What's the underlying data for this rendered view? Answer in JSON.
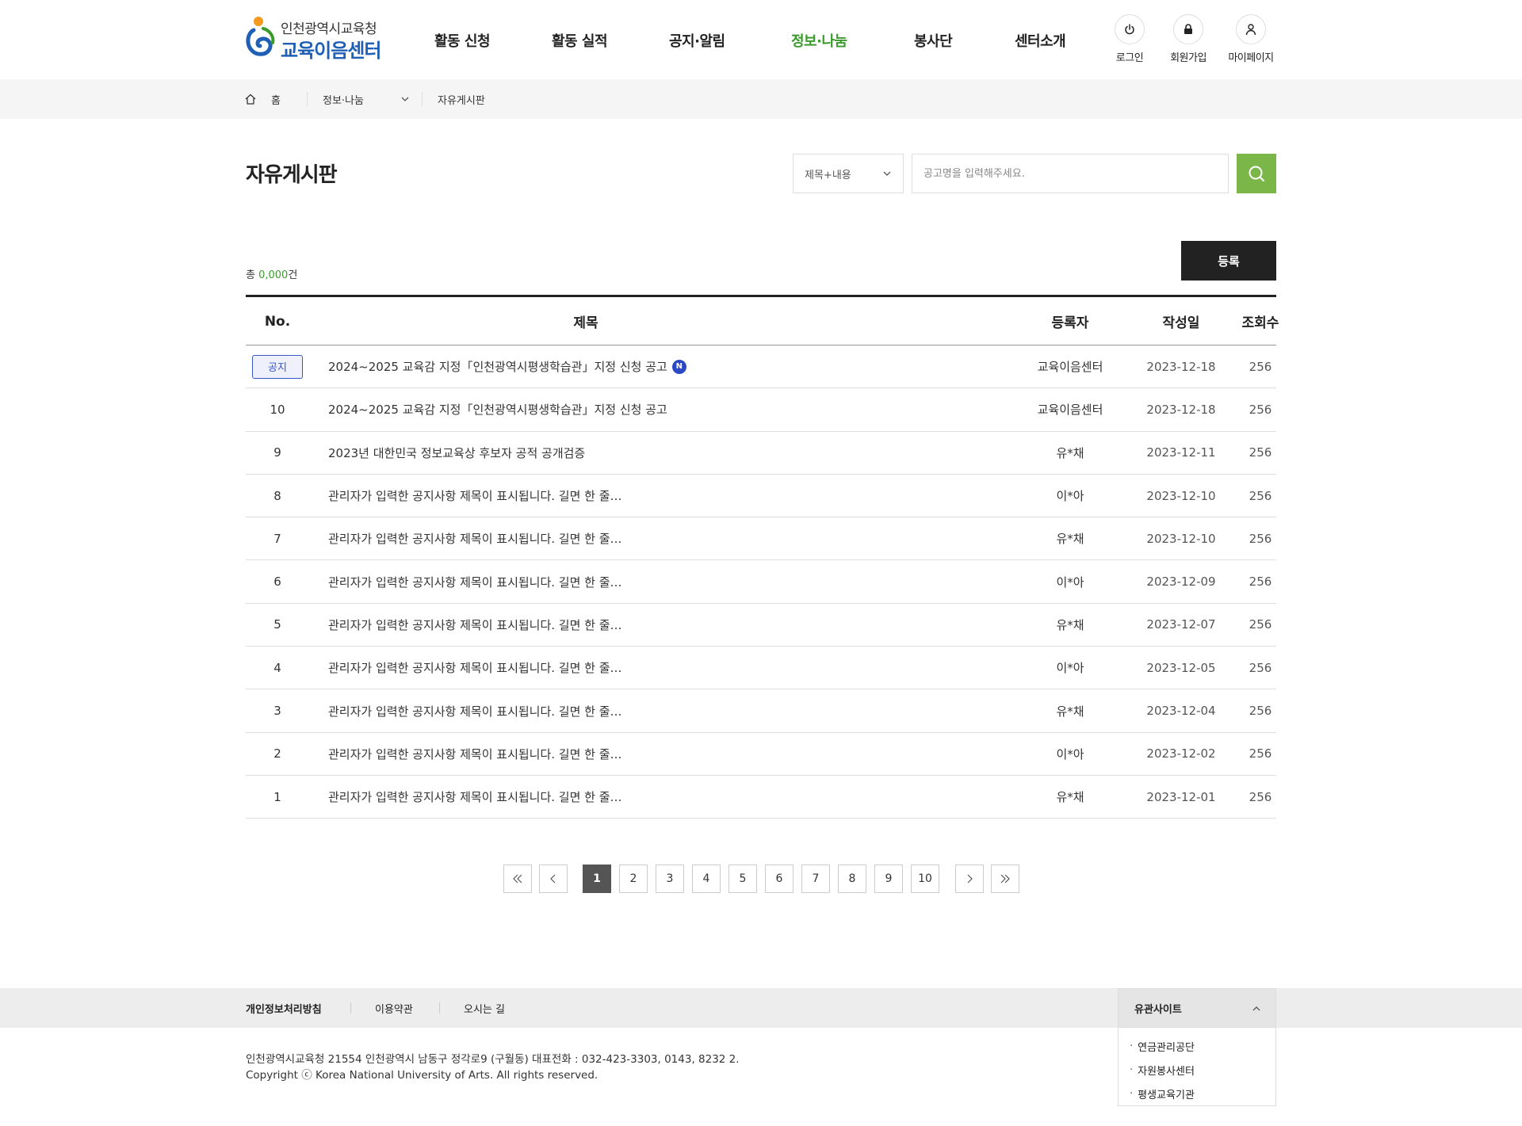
{
  "header": {
    "logo_top": "인천광역시교육청",
    "logo_main": "교육이음센터",
    "nav": [
      {
        "label": "활동 신청",
        "active": false
      },
      {
        "label": "활동 실적",
        "active": false
      },
      {
        "label": "공지·알림",
        "active": false
      },
      {
        "label": "정보·나눔",
        "active": true
      },
      {
        "label": "봉사단",
        "active": false
      },
      {
        "label": "센터소개",
        "active": false
      }
    ],
    "util": [
      {
        "label": "로그인",
        "icon": "power-icon"
      },
      {
        "label": "회원가입",
        "icon": "lock-icon"
      },
      {
        "label": "마이페이지",
        "icon": "user-icon"
      }
    ]
  },
  "breadcrumb": {
    "home": "홈",
    "section": "정보·나눔",
    "current": "자유게시판"
  },
  "page": {
    "title": "자유게시판"
  },
  "search": {
    "select_value": "제목+내용",
    "placeholder": "공고명을 입력해주세요."
  },
  "list": {
    "total_prefix": "총 ",
    "total_count": "0,000",
    "total_suffix": "건",
    "register_label": "등록",
    "columns": [
      "No.",
      "제목",
      "등록자",
      "작성일",
      "조회수"
    ],
    "notice_label": "공지",
    "new_label": "N",
    "rows": [
      {
        "no": "",
        "notice": true,
        "new": true,
        "title": "2024~2025 교육감 지정「인천광역시평생학습관」지정 신청 공고",
        "writer": "교육이음센터",
        "date": "2023-12-18",
        "views": "256"
      },
      {
        "no": "10",
        "notice": false,
        "new": false,
        "title": "2024~2025 교육감 지정「인천광역시평생학습관」지정 신청 공고",
        "writer": "교육이음센터",
        "date": "2023-12-18",
        "views": "256"
      },
      {
        "no": "9",
        "notice": false,
        "new": false,
        "title": "2023년 대한민국 정보교육상 후보자 공적 공개검증",
        "writer": "유*채",
        "date": "2023-12-11",
        "views": "256"
      },
      {
        "no": "8",
        "notice": false,
        "new": false,
        "title": "관리자가 입력한 공지사항 제목이 표시됩니다. 길면 한 줄…",
        "writer": "이*아",
        "date": "2023-12-10",
        "views": "256"
      },
      {
        "no": "7",
        "notice": false,
        "new": false,
        "title": "관리자가 입력한 공지사항 제목이 표시됩니다. 길면 한 줄…",
        "writer": "유*채",
        "date": "2023-12-10",
        "views": "256"
      },
      {
        "no": "6",
        "notice": false,
        "new": false,
        "title": "관리자가 입력한 공지사항 제목이 표시됩니다. 길면 한 줄…",
        "writer": "이*아",
        "date": "2023-12-09",
        "views": "256"
      },
      {
        "no": "5",
        "notice": false,
        "new": false,
        "title": "관리자가 입력한 공지사항 제목이 표시됩니다. 길면 한 줄…",
        "writer": "유*채",
        "date": "2023-12-07",
        "views": "256"
      },
      {
        "no": "4",
        "notice": false,
        "new": false,
        "title": "관리자가 입력한 공지사항 제목이 표시됩니다. 길면 한 줄…",
        "writer": "이*아",
        "date": "2023-12-05",
        "views": "256"
      },
      {
        "no": "3",
        "notice": false,
        "new": false,
        "title": "관리자가 입력한 공지사항 제목이 표시됩니다. 길면 한 줄…",
        "writer": "유*채",
        "date": "2023-12-04",
        "views": "256"
      },
      {
        "no": "2",
        "notice": false,
        "new": false,
        "title": "관리자가 입력한 공지사항 제목이 표시됩니다. 길면 한 줄…",
        "writer": "이*아",
        "date": "2023-12-02",
        "views": "256"
      },
      {
        "no": "1",
        "notice": false,
        "new": false,
        "title": "관리자가 입력한 공지사항 제목이 표시됩니다. 길면 한 줄…",
        "writer": "유*채",
        "date": "2023-12-01",
        "views": "256"
      }
    ]
  },
  "pagination": {
    "pages": [
      "1",
      "2",
      "3",
      "4",
      "5",
      "6",
      "7",
      "8",
      "9",
      "10"
    ],
    "current": "1"
  },
  "footer": {
    "links": [
      "개인정보처리방침",
      "이용약관",
      "오시는 길"
    ],
    "family_title": "유관사이트",
    "family_sites": [
      "연금관리공단",
      "자원봉사센터",
      "평생교육기관"
    ],
    "address": "인천광역시교육청 21554 인천광역시 남동구 정각로9 (구월동) 대표전화 : 032-423-3303, 0143, 8232 2.",
    "copyright": "Copyright ⓒ Korea National University of Arts. All rights reserved."
  },
  "colors": {
    "accent": "#7ab648",
    "nav_active": "#3a9b2c",
    "brand_blue": "#1f5fb5",
    "notice_blue": "#3b56c9",
    "dark_button": "#222222"
  }
}
